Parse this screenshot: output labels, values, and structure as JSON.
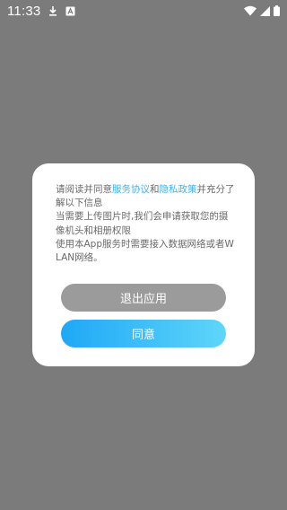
{
  "status_bar": {
    "time": "11:33",
    "icons": [
      "download-icon",
      "notification-a-icon",
      "wifi-icon",
      "signal-icon",
      "battery-icon"
    ],
    "color": "#ffffff"
  },
  "overlay_color": "#7b7b7b",
  "dialog": {
    "text_prefix": "请阅读并同意",
    "link_service": "服务协议",
    "text_and": "和",
    "link_privacy": "隐私政策",
    "text_after_links": "并充分了解以下信息",
    "line_camera": "当需要上传图片时,我们会申请获取您的摄像机头和相册权限",
    "line_network": "使用本App服务时需要接入数据网络或者WLAN网络。",
    "link_color": "#3db2f5",
    "exit_button_label": "退出应用",
    "agree_button_label": "同意",
    "exit_button_color": "#9b9b9b",
    "agree_button_gradient": [
      "#1ea8f6",
      "#5fd6fa"
    ]
  }
}
